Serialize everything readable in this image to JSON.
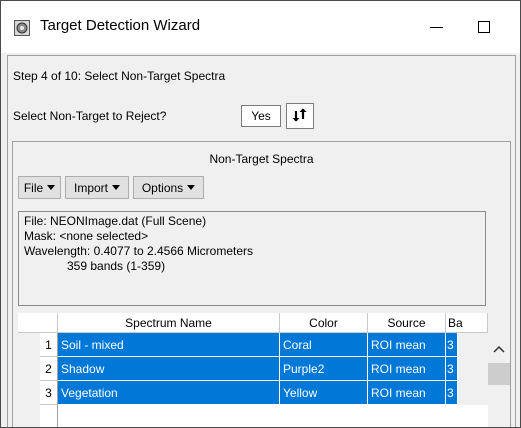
{
  "window": {
    "title": "Target Detection Wizard"
  },
  "step": {
    "label": "Step 4 of 10: Select Non-Target Spectra",
    "reject_label": "Select Non-Target to Reject?",
    "reject_value": "Yes"
  },
  "panel": {
    "title": "Non-Target Spectra",
    "menus": [
      {
        "label": "File"
      },
      {
        "label": "Import"
      },
      {
        "label": "Options"
      }
    ]
  },
  "info": {
    "file": "File: NEONImage.dat (Full Scene)",
    "mask": "Mask: <none selected>",
    "wavelength": "Wavelength: 0.4077 to 2.4566 Micrometers",
    "bands": "359 bands (1-359)"
  },
  "table": {
    "columns": [
      "Spectrum Name",
      "Color",
      "Source",
      "Ba"
    ],
    "rows": [
      {
        "num": "1",
        "name": "Soil - mixed",
        "color": "Coral",
        "source": "ROI mean",
        "bands": "3"
      },
      {
        "num": "2",
        "name": "Shadow",
        "color": "Purple2",
        "source": "ROI mean",
        "bands": "3"
      },
      {
        "num": "3",
        "name": "Vegetation",
        "color": "Yellow",
        "source": "ROI mean",
        "bands": "3"
      }
    ]
  },
  "colors": {
    "selection": "#0078d7",
    "window_bg": "#f0f0f0"
  }
}
